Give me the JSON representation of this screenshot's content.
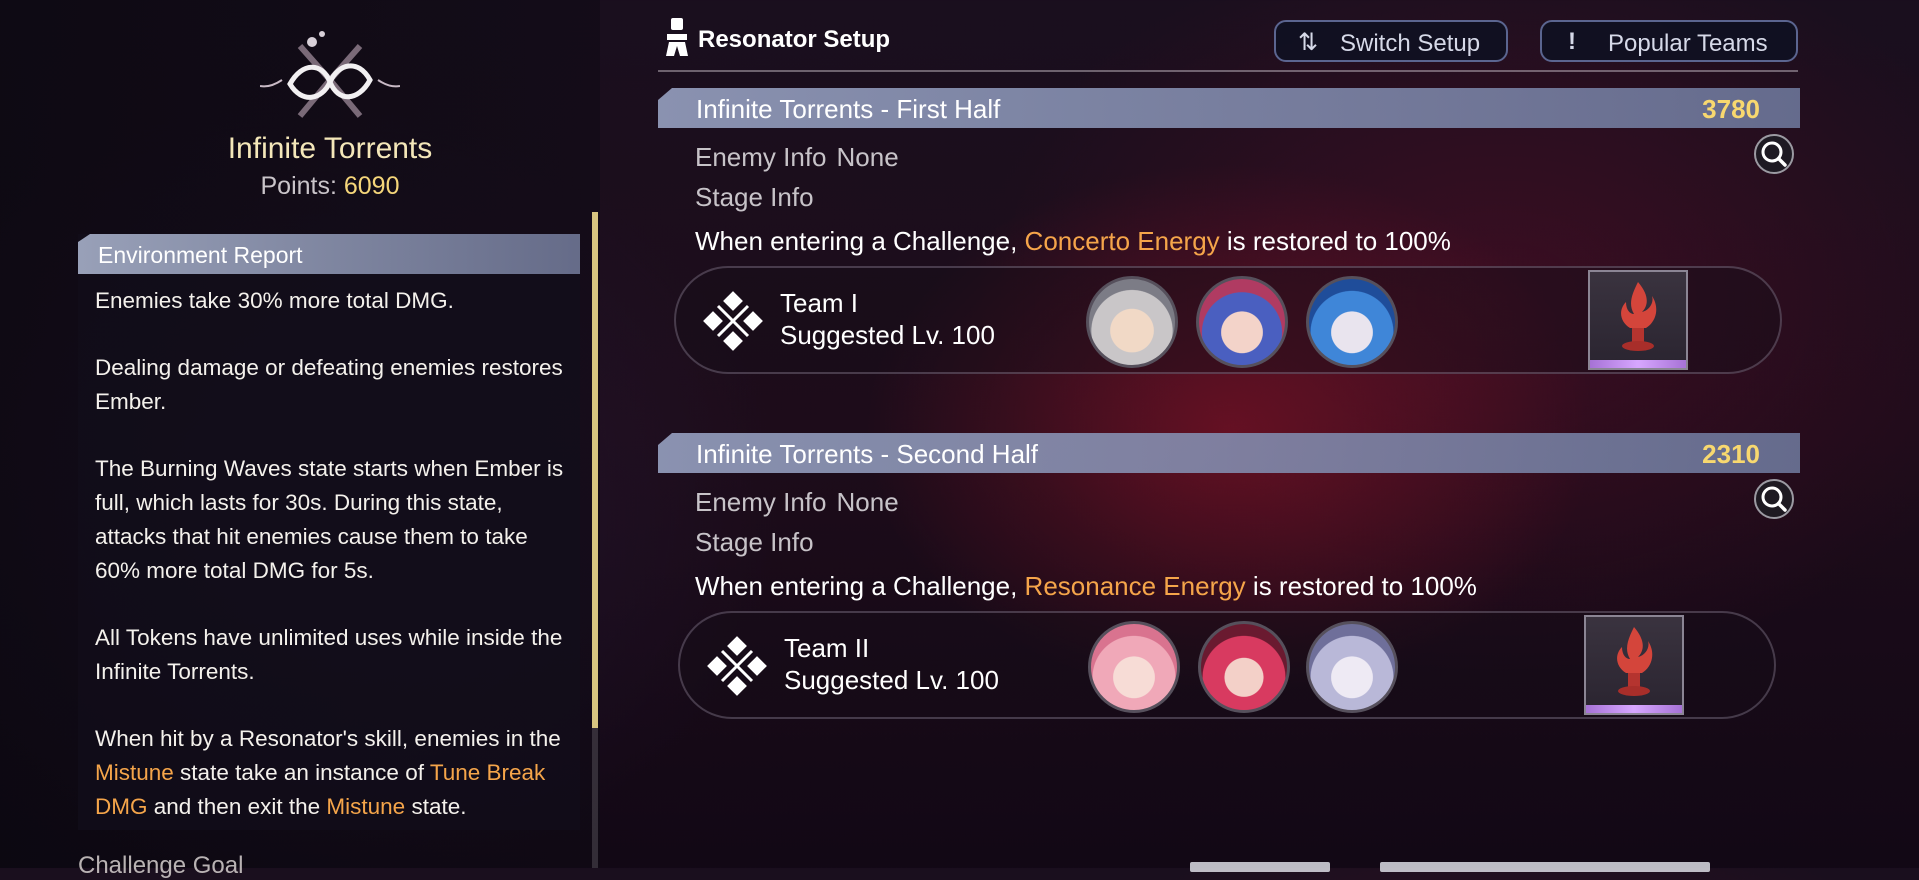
{
  "mode": {
    "title": "Infinite Torrents",
    "points_label": "Points:",
    "points_value": "6090"
  },
  "environment": {
    "header": "Environment Report",
    "paragraphs": [
      {
        "text": "Enemies take 30% more total DMG."
      },
      {
        "text": "Dealing damage or defeating enemies restores Ember."
      },
      {
        "text": "The Burning Waves state starts when Ember is full, which lasts for 30s. During this state, attacks that hit enemies cause them to take 60% more total DMG for 5s."
      },
      {
        "text": "All Tokens have unlimited uses while inside the Infinite Torrents."
      },
      {
        "part1": "When hit by a Resonator's skill, enemies in the ",
        "highlight1": "Mistune",
        "part2": " state take an instance of ",
        "highlight2": "Tune Break DMG",
        "part3": " and then exit the ",
        "highlight3": "Mistune",
        "part4": " state."
      }
    ],
    "next_section": "Challenge Goal"
  },
  "setup": {
    "title": "Resonator Setup",
    "switch_button": "Switch Setup",
    "popular_button": "Popular Teams",
    "switch_icon": "swap-sort-icon",
    "popular_icon": "exclamation-icon"
  },
  "halves": [
    {
      "title": "Infinite Torrents - First Half",
      "score": "3780",
      "enemy_label": "Enemy Info",
      "enemy_value": "None",
      "stage_label": "Stage Info",
      "desc_prefix": "When entering a Challenge, ",
      "desc_highlight": "Concerto Energy",
      "desc_suffix": " is restored to 100%",
      "team_name": "Team I",
      "team_level": "Suggested Lv. 100"
    },
    {
      "title": "Infinite Torrents - Second Half",
      "score": "2310",
      "enemy_label": "Enemy Info",
      "enemy_value": "None",
      "stage_label": "Stage Info",
      "desc_prefix": "When entering a Challenge, ",
      "desc_highlight": "Resonance Energy",
      "desc_suffix": " is restored to 100%",
      "team_name": "Team II",
      "team_level": "Suggested Lv. 100"
    }
  ],
  "colors": {
    "accent_gold": "#f5d67a",
    "highlight_orange": "#f5a54a",
    "token_glow": "#c28be8"
  }
}
